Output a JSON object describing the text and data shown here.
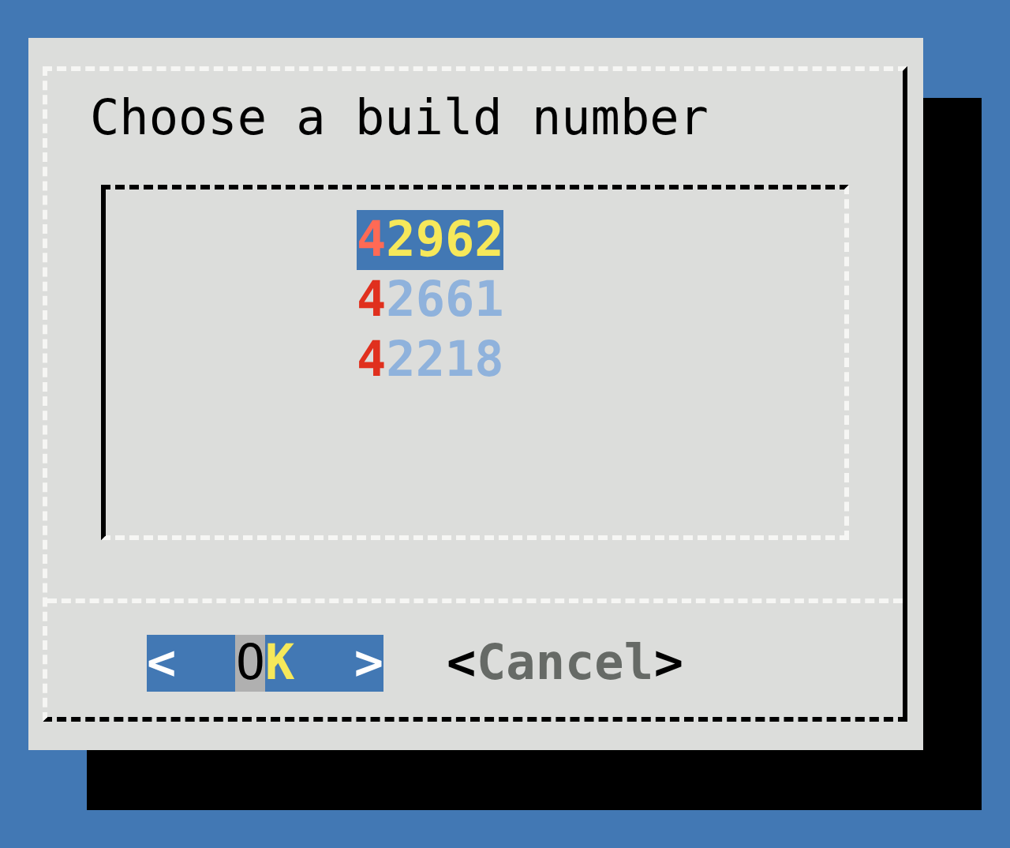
{
  "dialog": {
    "prompt": "Choose a build number",
    "items": [
      {
        "label": "42962",
        "selected": true
      },
      {
        "label": "42661",
        "selected": false
      },
      {
        "label": "42218",
        "selected": false
      }
    ],
    "buttons": [
      {
        "open": "<",
        "label": "OK",
        "close": ">",
        "selected": true
      },
      {
        "open": "<",
        "label": "Cancel",
        "close": ">",
        "selected": false
      }
    ]
  }
}
